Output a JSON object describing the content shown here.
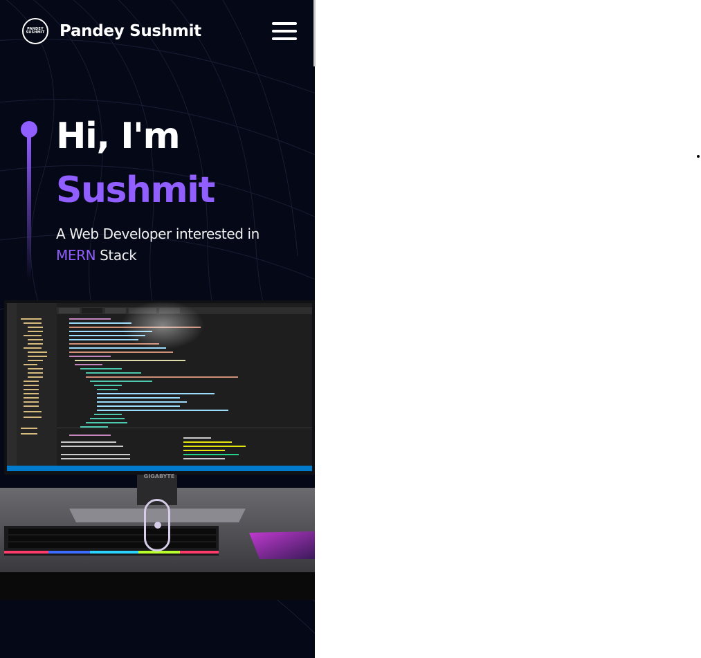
{
  "header": {
    "logo_text_line1": "PANDEY",
    "logo_text_line2": "SUSHMIT",
    "brand": "Pandey Sushmit",
    "menu_icon": "hamburger-menu-icon"
  },
  "hero": {
    "greeting": "Hi, I'm",
    "name": "Sushmit",
    "subtitle_prefix": "A Web Developer interested in",
    "subtitle_highlight": "MERN",
    "subtitle_suffix": " Stack"
  },
  "scene": {
    "monitor_brand": "GIGABYTE"
  },
  "scroll_indicator_icon": "mouse-scroll-icon",
  "colors": {
    "background": "#050816",
    "accent": "#915eff",
    "text": "#ffffff"
  }
}
